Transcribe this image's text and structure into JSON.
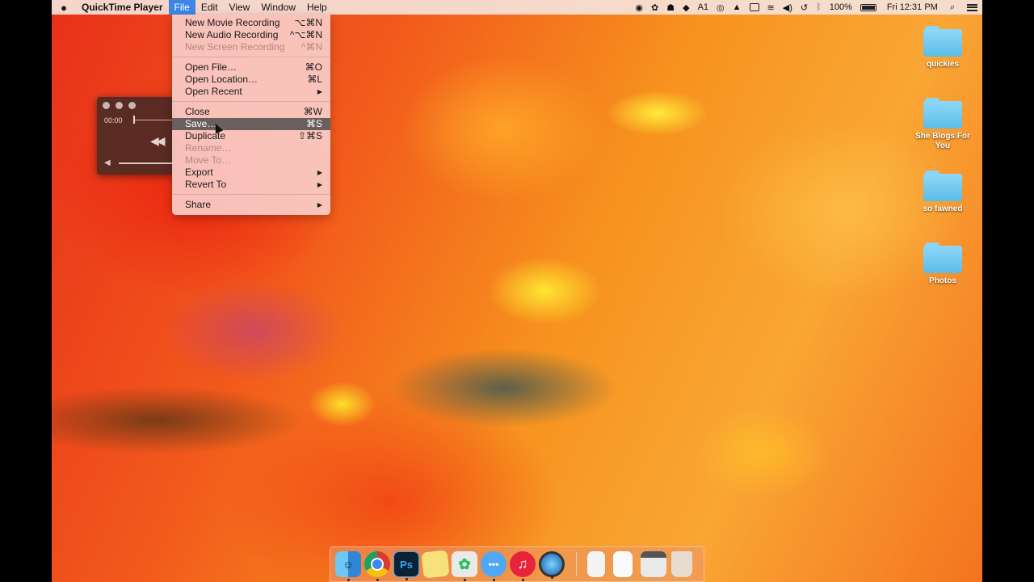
{
  "menubar": {
    "apple": "",
    "app_name": "QuickTime Player",
    "items": [
      "File",
      "Edit",
      "View",
      "Window",
      "Help"
    ],
    "status": {
      "adobe_count": "1",
      "battery": "100%",
      "clock": "Fri 12:31 PM"
    }
  },
  "file_menu": {
    "items": [
      {
        "label": "New Movie Recording",
        "shortcut": "⌥⌘N",
        "state": "enabled"
      },
      {
        "label": "New Audio Recording",
        "shortcut": "^⌥⌘N",
        "state": "enabled"
      },
      {
        "label": "New Screen Recording",
        "shortcut": "^⌘N",
        "state": "disabled"
      },
      {
        "label": "Open File…",
        "shortcut": "⌘O",
        "state": "enabled"
      },
      {
        "label": "Open Location…",
        "shortcut": "⌘L",
        "state": "enabled"
      },
      {
        "label": "Open Recent",
        "shortcut": "▶",
        "state": "enabled"
      },
      {
        "label": "Close",
        "shortcut": "⌘W",
        "state": "enabled"
      },
      {
        "label": "Save…",
        "shortcut": "⌘S",
        "state": "highlighted"
      },
      {
        "label": "Duplicate",
        "shortcut": "⇧⌘S",
        "state": "enabled"
      },
      {
        "label": "Rename…",
        "shortcut": "",
        "state": "disabled"
      },
      {
        "label": "Move To…",
        "shortcut": "",
        "state": "disabled"
      },
      {
        "label": "Export",
        "shortcut": "▶",
        "state": "enabled"
      },
      {
        "label": "Revert To",
        "shortcut": "▶",
        "state": "enabled"
      },
      {
        "label": "Share",
        "shortcut": "▶",
        "state": "enabled"
      }
    ]
  },
  "player": {
    "time": "00:00",
    "rewind_icon": "rewind-icon",
    "volume_icon": "speaker-icon"
  },
  "desktop": {
    "folders": [
      "quickies",
      "She Blogs For You",
      "so fawned",
      "Photos"
    ]
  },
  "dock": {
    "apps": [
      "Finder",
      "Chrome",
      "Photoshop",
      "Notes",
      "Evernote",
      "Messages",
      "iTunes",
      "QuickTime Player",
      "Document",
      "Document",
      "Preview",
      "Trash"
    ],
    "photoshop_label": "Ps"
  },
  "colors": {
    "menu_highlight": "#3d86e8",
    "selected_item": "#6a5f5f",
    "folder": "#6cc6ef"
  }
}
